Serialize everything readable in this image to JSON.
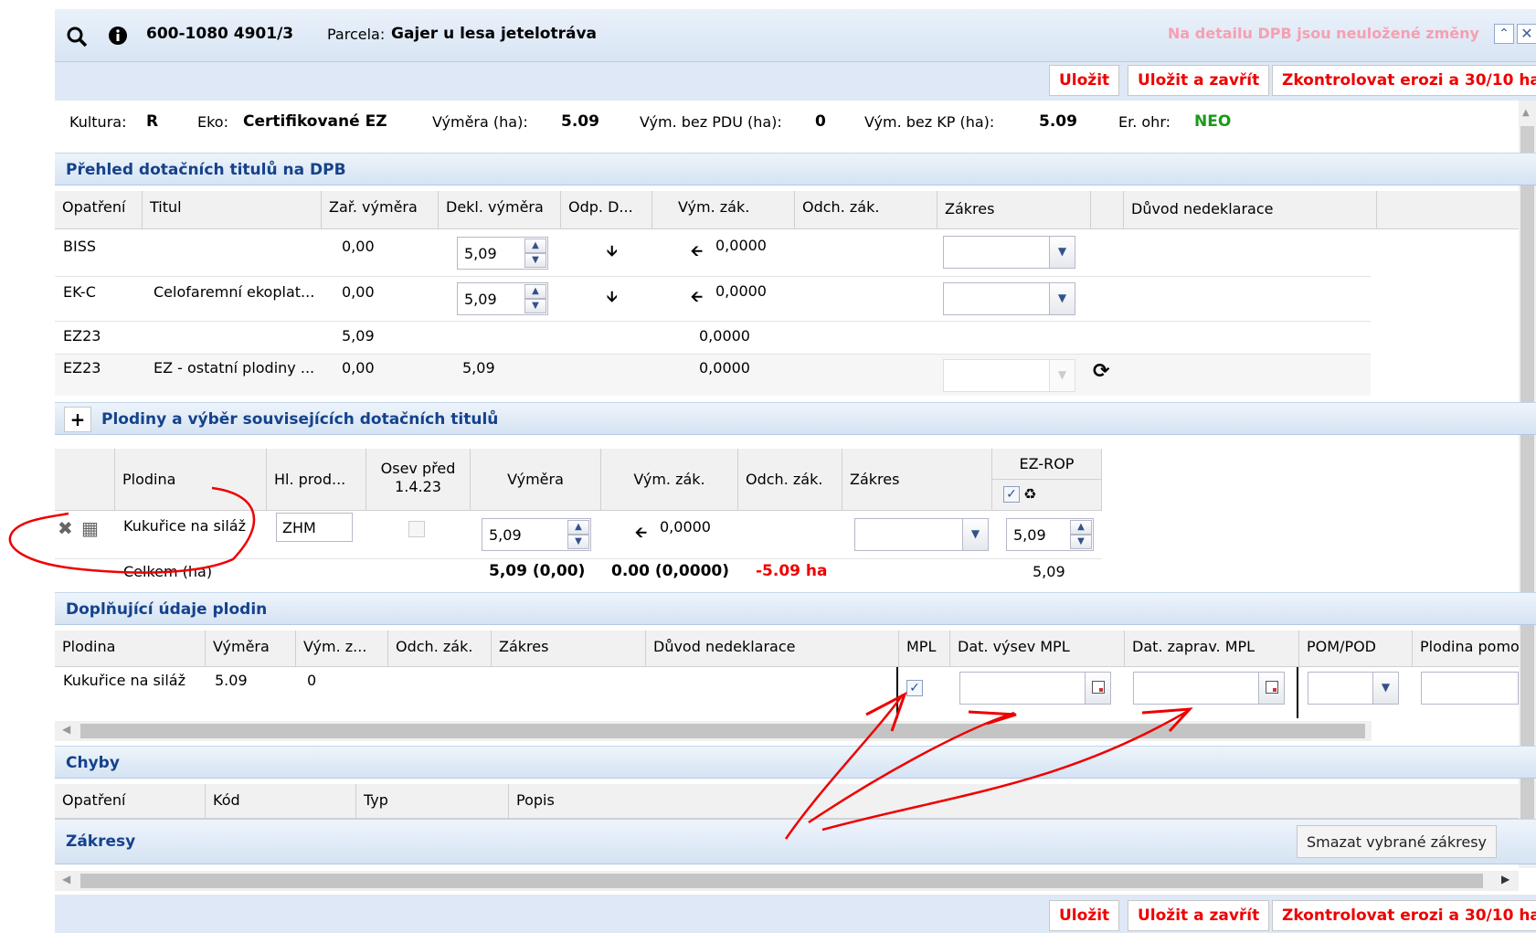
{
  "header": {
    "search_icon": "search-icon",
    "info_icon": "info-icon",
    "id": "600-1080 4901/3",
    "parcel_label": "Parcela:",
    "parcel_name": "Gajer u lesa jetelotráva",
    "warning": "Na detailu DPB jsou neuložené změny"
  },
  "toolbar": {
    "save": "Uložit",
    "save_close": "Uložit a zavřít",
    "check": "Zkontrolovat erozi a 30/10 ha"
  },
  "summary": {
    "kultura_label": "Kultura:",
    "kultura": "R",
    "eko_label": "Eko:",
    "eko": "Certifikované EZ",
    "vymera_label": "Výměra (ha):",
    "vymera": "5.09",
    "pdu_label": "Vým. bez PDU (ha):",
    "pdu": "0",
    "kp_label": "Vým. bez KP (ha):",
    "kp": "5.09",
    "er_label": "Er. ohr:",
    "er": "NEO",
    "er_color": "#1a9a1a"
  },
  "sec1": {
    "title": "Přehled dotačních titulů na DPB",
    "cols": [
      "Opatření",
      "Titul",
      "Zař. výměra",
      "Dekl. výměra",
      "Odp. D...",
      "Vým. zák.",
      "Odch. zák.",
      "Zákres",
      "",
      "Důvod nedeklarace"
    ],
    "rows": [
      {
        "op": "BISS",
        "titul": "",
        "zar": "0,00",
        "dekl": "5,09",
        "vymzak": "0,0000"
      },
      {
        "op": "EK-C",
        "titul": "Celofaremní ekoplat...",
        "zar": "0,00",
        "dekl": "5,09",
        "vymzak": "0,0000"
      },
      {
        "op": "EZ23",
        "titul": "",
        "zar": "5,09",
        "dekl": "",
        "vymzak": "0,0000"
      },
      {
        "op": "EZ23",
        "titul": "EZ - ostatní plodiny ...",
        "zar": "0,00",
        "dekl": "5,09",
        "vymzak": "0,0000"
      }
    ]
  },
  "sec2": {
    "title": "Plodiny a výběr souvisejících dotačních titulů",
    "cols": [
      "Plodina",
      "Hl. prod...",
      "Osev před 1.4.23",
      "Výměra",
      "Vým. zák.",
      "Odch. zák.",
      "Zákres",
      "EZ-ROP"
    ],
    "row": {
      "plodina": "Kukuřice na siláž",
      "hlprod": "ZHM",
      "vymera": "5,09",
      "vymzak": "0,0000",
      "ezrop": "5,09"
    },
    "total": {
      "label": "Celkem (ha)",
      "vymera": "5,09 (0,00)",
      "vymzak": "0.00 (0,0000)",
      "odch": "-5.09 ha",
      "ezrop": "5,09"
    }
  },
  "sec3": {
    "title": "Doplňující údaje plodin",
    "cols": [
      "Plodina",
      "Výměra",
      "Vým. z...",
      "Odch. zák.",
      "Zákres",
      "Důvod nedeklarace",
      "MPL",
      "Dat. výsev MPL",
      "Dat. zaprav. MPL",
      "POM/POD",
      "Plodina pomo"
    ],
    "row": {
      "plodina": "Kukuřice na siláž",
      "vymera": "5.09",
      "vymz": "0"
    }
  },
  "sec4": {
    "title": "Chyby",
    "cols": [
      "Opatření",
      "Kód",
      "Typ",
      "Popis"
    ]
  },
  "sec5": {
    "title": "Zákresy",
    "button": "Smazat vybrané zákresy"
  }
}
